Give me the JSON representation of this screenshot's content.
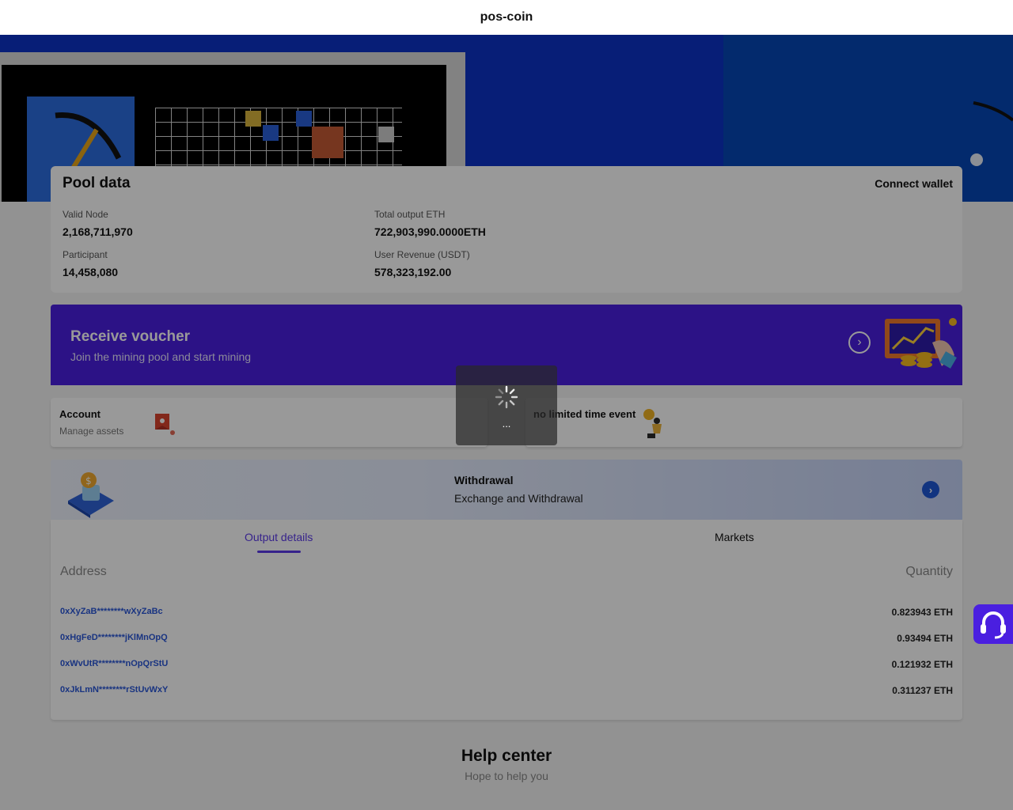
{
  "app": {
    "title": "pos-coin"
  },
  "pool": {
    "title": "Pool data",
    "connect_label": "Connect wallet",
    "stats": [
      {
        "label": "Valid Node",
        "value": "2,168,711,970"
      },
      {
        "label": "Total output ETH",
        "value": "722,903,990.0000ETH"
      },
      {
        "label": "Participant",
        "value": "14,458,080"
      },
      {
        "label": "User Revenue (USDT)",
        "value": "578,323,192.00"
      }
    ]
  },
  "voucher": {
    "title": "Receive voucher",
    "subtitle": "Join the mining pool and start mining"
  },
  "account": {
    "title": "Account",
    "subtitle": "Manage assets"
  },
  "event": {
    "title": "no limited time event"
  },
  "withdraw": {
    "title": "Withdrawal",
    "subtitle": "Exchange and Withdrawal"
  },
  "tabs": [
    {
      "label": "Output details",
      "active": true
    },
    {
      "label": "Markets",
      "active": false
    }
  ],
  "table": {
    "headers": [
      "Address",
      "Quantity"
    ],
    "rows": [
      {
        "address": "0xXyZaB********wXyZaBc",
        "quantity": "0.823943 ETH"
      },
      {
        "address": "0xHgFeD********jKlMnOpQ",
        "quantity": "0.93494 ETH"
      },
      {
        "address": "0xWvUtR********nOpQrStU",
        "quantity": "0.121932 ETH"
      },
      {
        "address": "0xJkLmN********rStUvWxY",
        "quantity": "0.311237 ETH"
      }
    ]
  },
  "help": {
    "title": "Help center",
    "subtitle": "Hope to help you"
  },
  "loading": {
    "text": "..."
  },
  "colors": {
    "primary": "#4a1fe0",
    "hero_blue": "#0c33c7",
    "link_blue": "#2b57d8"
  }
}
